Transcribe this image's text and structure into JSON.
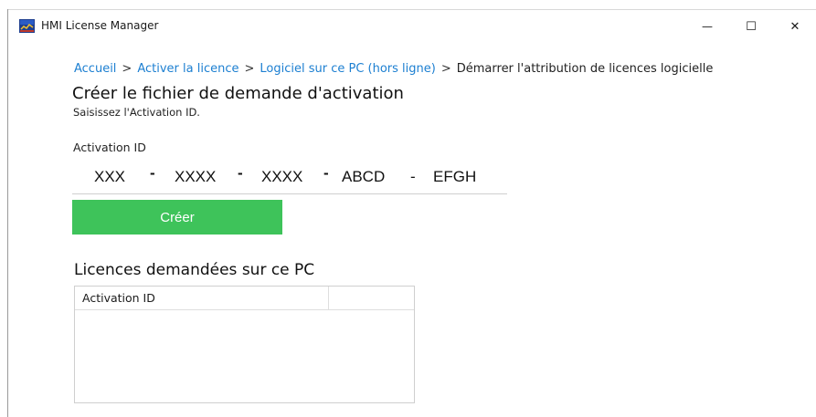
{
  "window": {
    "title": "HMI License Manager",
    "controls": {
      "minimize": "—",
      "maximize": "☐",
      "close": "✕"
    }
  },
  "breadcrumb": {
    "items": [
      {
        "label": "Accueil",
        "link": true
      },
      {
        "label": "Activer la licence",
        "link": true
      },
      {
        "label": "Logiciel sur ce PC (hors ligne)",
        "link": true
      },
      {
        "label": "Démarrer l'attribution de licences logicielle",
        "link": false
      }
    ],
    "separator": ">"
  },
  "page": {
    "title": "Créer le fichier de demande d'activation",
    "subtitle": "Saisissez l'Activation ID."
  },
  "activation_field": {
    "label": "Activation ID",
    "segments": [
      "XXX",
      "XXXX",
      "XXXX",
      "ABCD",
      "EFGH"
    ],
    "separators": [
      "-",
      "-",
      "-",
      "-"
    ]
  },
  "create_button": {
    "label": "Créer",
    "color": "#3ec35a"
  },
  "requested_licenses": {
    "title": "Licences demandées sur ce PC",
    "columns": [
      "Activation ID",
      ""
    ],
    "rows": []
  },
  "colors": {
    "link": "#1c7fd1",
    "accent": "#3ec35a"
  }
}
